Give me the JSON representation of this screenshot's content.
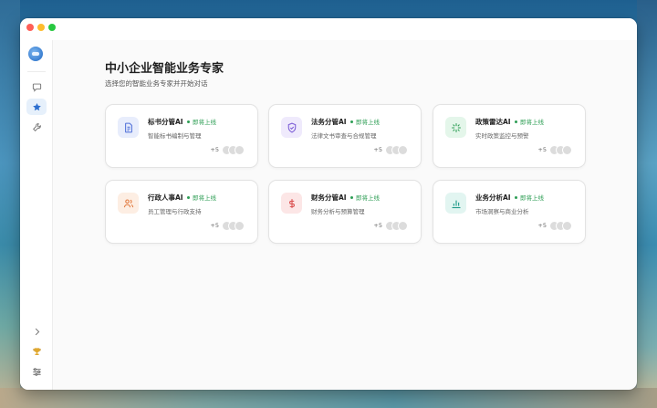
{
  "header": {
    "title": "中小企业智能业务专家",
    "subtitle": "选择您的智能业务专家并开始对话"
  },
  "sidebar": {
    "items": [
      {
        "name": "chat",
        "icon": "chat-bubble-icon"
      },
      {
        "name": "favorites",
        "icon": "star-icon",
        "active": true
      },
      {
        "name": "tools",
        "icon": "wrench-icon"
      }
    ],
    "bottom": [
      {
        "name": "expand",
        "icon": "chevron-right-icon"
      },
      {
        "name": "trophy",
        "icon": "trophy-icon"
      },
      {
        "name": "settings",
        "icon": "sliders-icon"
      }
    ]
  },
  "cards": [
    {
      "title": "标书分管AI",
      "badge": "即将上线",
      "desc": "智能标书编制与管理",
      "count": "+5",
      "icon": "document-icon",
      "icon_color": "#4f6fd8",
      "icon_bg": "#e8edfc"
    },
    {
      "title": "法务分管AI",
      "badge": "即将上线",
      "desc": "法律文书审查与合规管理",
      "count": "+5",
      "icon": "shield-check-icon",
      "icon_color": "#7b5cd6",
      "icon_bg": "#efeafc"
    },
    {
      "title": "政策雷达AI",
      "badge": "即将上线",
      "desc": "实时政策监控与预警",
      "count": "+5",
      "icon": "sparkle-icon",
      "icon_color": "#2e9e55",
      "icon_bg": "#e4f6ea"
    },
    {
      "title": "行政人事AI",
      "badge": "即将上线",
      "desc": "员工管理与行政支持",
      "count": "+5",
      "icon": "users-icon",
      "icon_color": "#e27a3f",
      "icon_bg": "#fdeee3"
    },
    {
      "title": "财务分管AI",
      "badge": "即将上线",
      "desc": "财务分析与预算管理",
      "count": "+5",
      "icon": "dollar-icon",
      "icon_color": "#d94b4b",
      "icon_bg": "#fce6e6"
    },
    {
      "title": "业务分析AI",
      "badge": "即将上线",
      "desc": "市场洞察与商业分析",
      "count": "+5",
      "icon": "bar-chart-icon",
      "icon_color": "#1f9a8a",
      "icon_bg": "#e2f5f1"
    }
  ],
  "colors": {
    "accent": "#3a7fd1",
    "badge": "#2e9e55"
  }
}
